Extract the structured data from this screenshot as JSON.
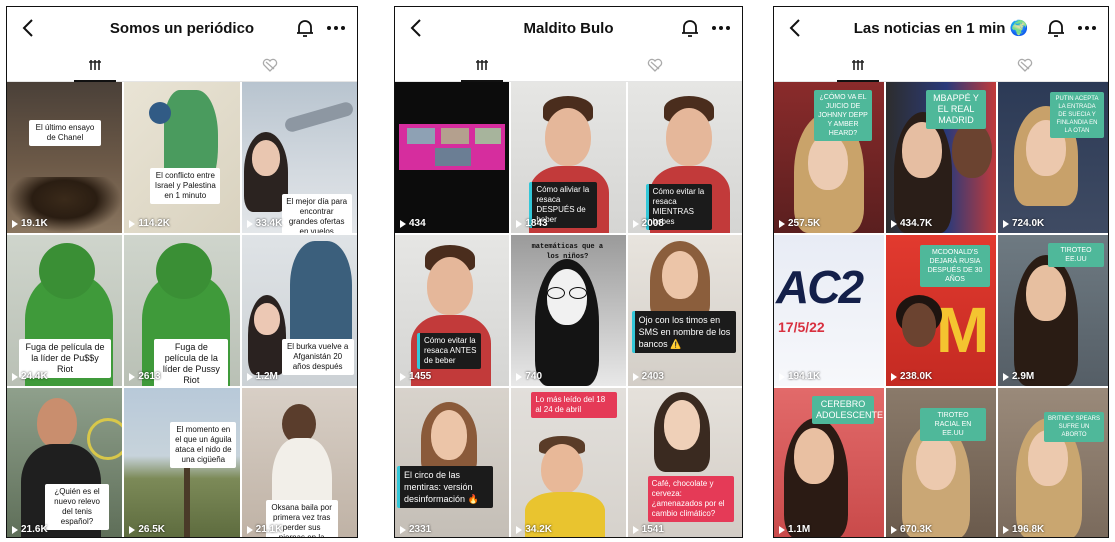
{
  "phones": [
    {
      "title": "Somos un periódico",
      "videos": [
        {
          "caption": "El último ensayo de Chanel",
          "views": "19.1K"
        },
        {
          "caption": "El conflicto entre Israel y Palestina en 1 minuto",
          "views": "114.2K"
        },
        {
          "caption": "El mejor día para encontrar grandes ofertas en vuelos",
          "views": "33.4K"
        },
        {
          "caption": "Fuga de película de la líder de Pu$$y Riot",
          "views": "24.4K"
        },
        {
          "caption": "Fuga de película de la líder de Pussy Riot",
          "views": "2613"
        },
        {
          "caption": "El burka vuelve a Afganistán 20 años después",
          "views": "1.2M"
        },
        {
          "caption": "¿Quién es el nuevo relevo del tenis español?",
          "views": "21.6K"
        },
        {
          "caption": "El momento en el que un águila ataca el nido de una cigüeña",
          "views": "26.5K"
        },
        {
          "caption": "Oksana baila por primera vez tras perder sus piernas en la guerra",
          "views": "21.1K"
        }
      ]
    },
    {
      "title": "Maldito Bulo",
      "videos": [
        {
          "caption": "",
          "views": "434"
        },
        {
          "caption": "Cómo aliviar la resaca DESPUÉS de beber",
          "views": "1843"
        },
        {
          "caption": "Cómo evitar la resaca MIENTRAS bebes",
          "views": "2008"
        },
        {
          "caption": "Cómo evitar la resaca ANTES de beber",
          "views": "1455"
        },
        {
          "caption": "matemáticas que a los niños?",
          "views": "740"
        },
        {
          "caption": "Ojo con los timos en SMS en nombre de los bancos ⚠️",
          "views": "2403"
        },
        {
          "caption": "El circo de las mentiras: versión desinformación 🔥",
          "views": "2331"
        },
        {
          "caption": "Lo más leído del 18 al 24 de abril",
          "views": "34.2K"
        },
        {
          "caption": "Café, chocolate y cerveza: ¿amenazados por el cambio climático?",
          "views": "1541"
        }
      ]
    },
    {
      "title": "Las noticias en 1 min 🌍",
      "videos": [
        {
          "caption": "¿CÓMO VA EL JUICIO DE JOHNNY DEPP Y AMBER HEARD?",
          "views": "257.5K"
        },
        {
          "caption": "MBAPPÉ Y EL REAL MADRID",
          "views": "434.7K"
        },
        {
          "caption": "PUTIN ACEPTA LA ENTRADA DE SUECIA Y FINLANDIA EN LA OTAN",
          "views": "724.0K"
        },
        {
          "caption": "AC2 17/5/22",
          "views": "194.1K"
        },
        {
          "caption": "MCDONALD'S DEJARÁ RUSIA DESPUÉS DE 30 AÑOS",
          "views": "238.0K"
        },
        {
          "caption": "TIROTEO EE.UU",
          "views": "2.9M"
        },
        {
          "caption": "CEREBRO ADOLESCENTE",
          "views": "1.1M"
        },
        {
          "caption": "TIROTEO RACIAL EN EE.UU",
          "views": "670.3K"
        },
        {
          "caption": "BRITNEY SPEARS SUFRE UN ABORTO",
          "views": "196.8K"
        }
      ]
    }
  ]
}
